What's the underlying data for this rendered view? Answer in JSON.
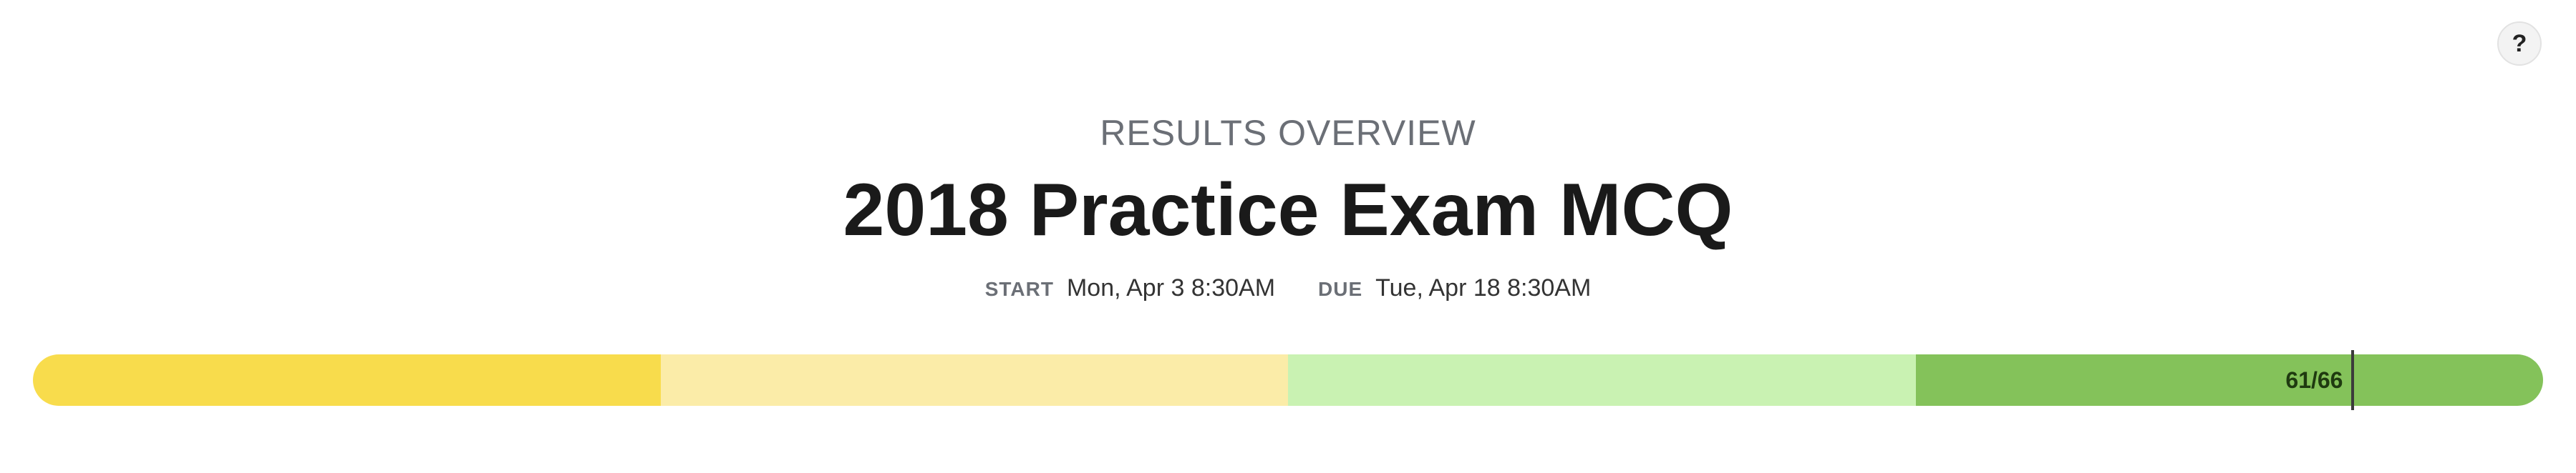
{
  "help": {
    "label": "?"
  },
  "header": {
    "overline": "RESULTS OVERVIEW",
    "title": "2018 Practice Exam MCQ"
  },
  "dates": {
    "start_label": "START",
    "start_value": "Mon, Apr 3 8:30AM",
    "due_label": "DUE",
    "due_value": "Tue, Apr 18 8:30AM"
  },
  "score": {
    "label": "61/66",
    "earned": 61,
    "total": 66
  },
  "bands": [
    {
      "name": "band-1",
      "color": "#f8dc4c"
    },
    {
      "name": "band-2",
      "color": "#fbeca8"
    },
    {
      "name": "band-3",
      "color": "#c9f2b2"
    },
    {
      "name": "band-4",
      "color": "#84c25a"
    }
  ]
}
